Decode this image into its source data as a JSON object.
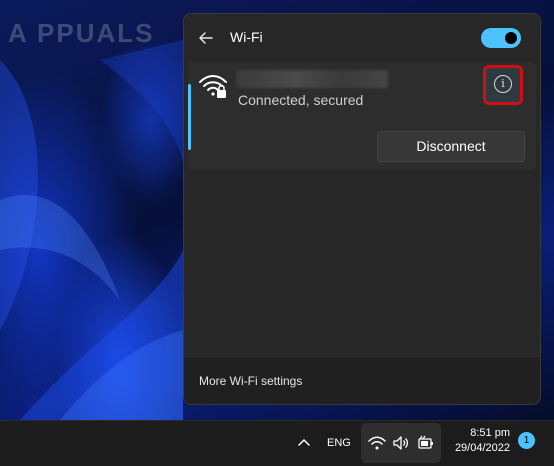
{
  "wifi_panel": {
    "title": "Wi-Fi",
    "toggle_on": true,
    "network": {
      "name": "",
      "status": "Connected, secured",
      "disconnect_label": "Disconnect"
    },
    "footer_link": "More Wi-Fi settings"
  },
  "taskbar": {
    "language": "ENG",
    "time": "8:51 pm",
    "date": "29/04/2022",
    "notification_count": "1"
  },
  "colors": {
    "accent": "#4cc2ff",
    "highlight_border": "#d01010",
    "panel_bg": "#272727"
  }
}
